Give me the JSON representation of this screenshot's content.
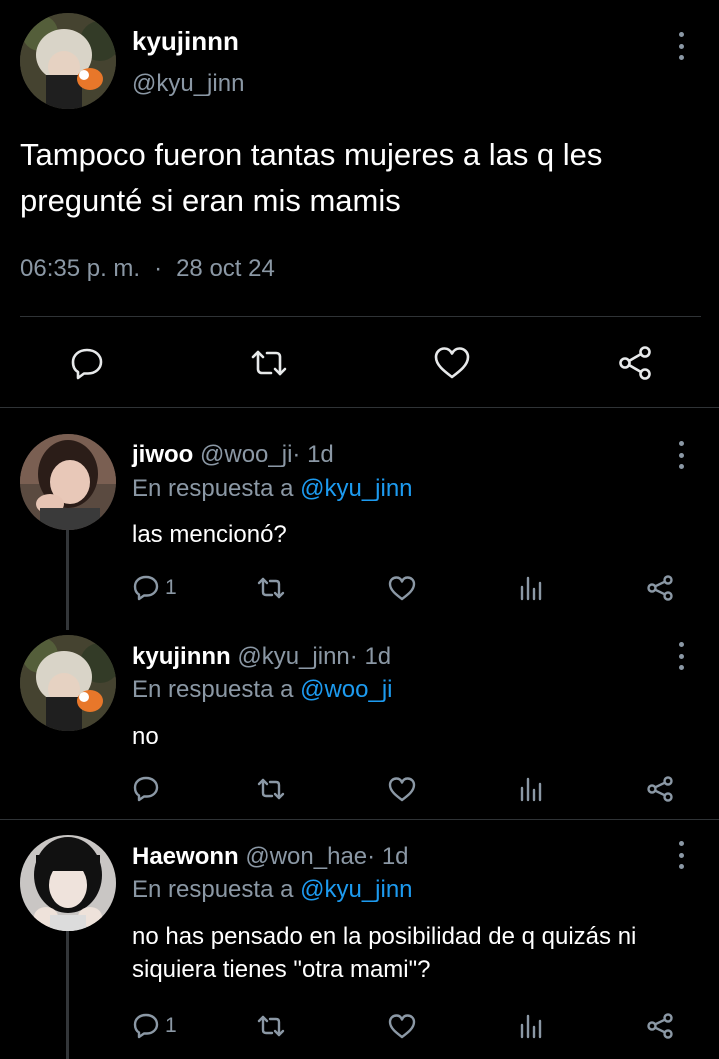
{
  "main_tweet": {
    "author_name": "kyujinnn",
    "author_handle": "@kyu_jinn",
    "text": "Tampoco fueron tantas mujeres a las q les pregunté si eran mis mamis",
    "time": "06:35 p. m.",
    "separator": "·",
    "date": "28 oct 24",
    "actions": [
      "reply-icon",
      "retweet-icon",
      "like-icon",
      "share-icon"
    ]
  },
  "replies": [
    {
      "name": "jiwoo",
      "handle": "@woo_ji",
      "sep": "·",
      "age": "1d",
      "reply_prefix": "En respuesta a",
      "reply_to": "@kyu_jinn",
      "text": "las mencionó?",
      "reply_count": "1",
      "avatar": "jiwoo-avatar"
    },
    {
      "name": "kyujinnn",
      "handle": "@kyu_jinn",
      "sep": "·",
      "age": "1d",
      "reply_prefix": "En respuesta a",
      "reply_to": "@woo_ji",
      "text": "no",
      "reply_count": "",
      "avatar": "kyujinnn-avatar"
    },
    {
      "name": "Haewonn",
      "handle": "@won_hae",
      "sep": "·",
      "age": "1d",
      "reply_prefix": "En respuesta a",
      "reply_to": "@kyu_jinn",
      "text": "no has pensado en la posibilidad de q quizás ni siquiera tienes \"otra mami\"?",
      "reply_count": "1",
      "avatar": "haewonn-avatar"
    }
  ],
  "colors": {
    "background": "#000000",
    "text": "#ffffff",
    "muted": "#8b98a5",
    "link": "#1d9bf0",
    "divider": "#2f3336"
  }
}
